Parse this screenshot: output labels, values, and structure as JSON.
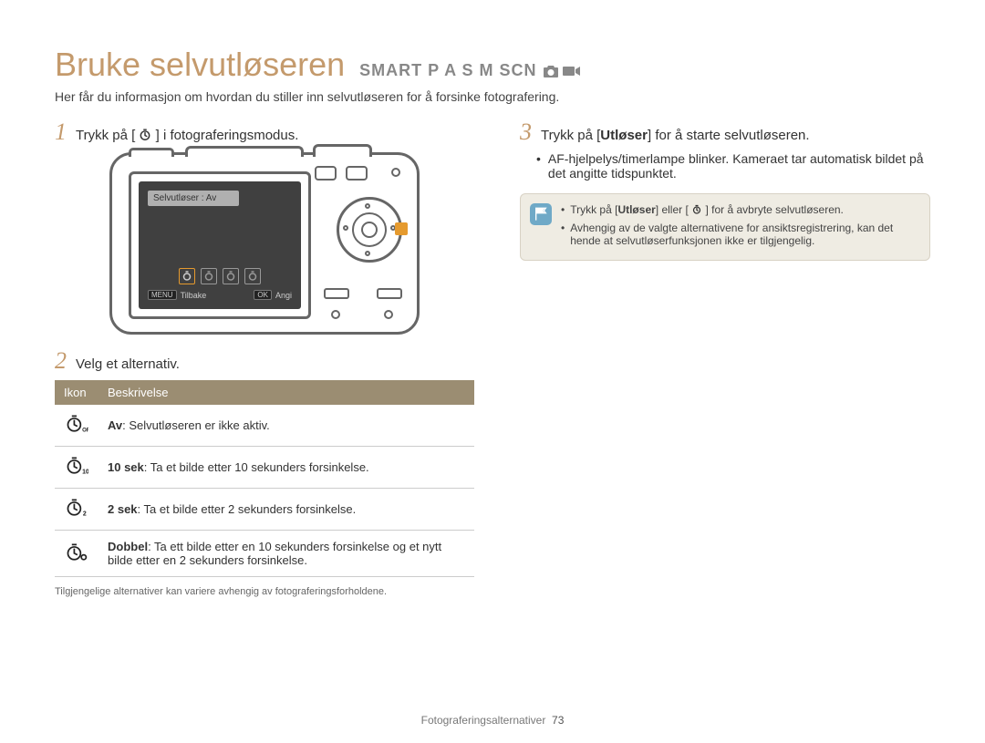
{
  "header": {
    "title": "Bruke selvutløseren",
    "modes": "SMART  P A S M SCN"
  },
  "intro": "Her får du informasjon om hvordan du stiller inn selvutløseren for å forsinke fotografering.",
  "left": {
    "step1_a": "Trykk på [",
    "step1_b": "] i fotograferingsmodus.",
    "camera": {
      "screen_title": "Selvutløser : Av",
      "back_btn": "MENU",
      "back_label": "Tilbake",
      "ok_btn": "OK",
      "ok_label": "Angi"
    },
    "step2": "Velg et alternativ.",
    "table": {
      "col_icon": "Ikon",
      "col_desc": "Beskrivelse",
      "rows": [
        {
          "bold": "Av",
          "rest": ": Selvutløseren er ikke aktiv."
        },
        {
          "bold": "10 sek",
          "rest": ": Ta et bilde etter 10 sekunders forsinkelse."
        },
        {
          "bold": "2 sek",
          "rest": ": Ta et bilde etter 2 sekunders forsinkelse."
        },
        {
          "bold": "Dobbel",
          "rest": ": Ta ett bilde etter en 10 sekunders forsinkelse og et nytt bilde etter en 2 sekunders forsinkelse."
        }
      ]
    },
    "footnote": "Tilgjengelige alternativer kan variere avhengig av fotograferingsforholdene."
  },
  "right": {
    "step3_a": "Trykk på [",
    "step3_bold": "Utløser",
    "step3_b": "] for å starte selvutløseren.",
    "bullet": "AF-hjelpelys/timerlampe blinker. Kameraet tar automatisk bildet på det angitte tidspunktet.",
    "tip1_a": "Trykk på [",
    "tip1_bold": "Utløser",
    "tip1_b": "] eller [",
    "tip1_c": "] for å avbryte selvutløseren.",
    "tip2": "Avhengig av de valgte alternativene for ansiktsregistrering, kan det hende at selvutløserfunksjonen ikke er tilgjengelig."
  },
  "footer": {
    "section": "Fotograferingsalternativer",
    "page": "73"
  }
}
